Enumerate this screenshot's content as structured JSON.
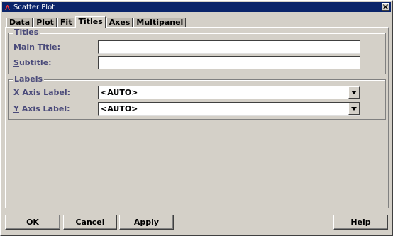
{
  "window": {
    "title": "Scatter Plot"
  },
  "tabs": [
    {
      "label": "Data",
      "active": false
    },
    {
      "label": "Plot",
      "active": false
    },
    {
      "label": "Fit",
      "active": false
    },
    {
      "label": "Titles",
      "active": true
    },
    {
      "label": "Axes",
      "active": false
    },
    {
      "label": "Multipanel",
      "active": false
    }
  ],
  "titles_group": {
    "legend": "Titles",
    "main_title": {
      "label": "Main Title:",
      "value": ""
    },
    "subtitle": {
      "label_mnemonic": "S",
      "label_rest": "ubtitle:",
      "value": ""
    }
  },
  "labels_group": {
    "legend": "Labels",
    "x_axis": {
      "label_mnemonic": "X",
      "label_rest": " Axis Label:",
      "value": "<AUTO>"
    },
    "y_axis": {
      "label_mnemonic": "Y",
      "label_rest": " Axis Label:",
      "value": "<AUTO>"
    }
  },
  "buttons": {
    "ok": "OK",
    "cancel": "Cancel",
    "apply": "Apply",
    "help": "Help"
  },
  "colors": {
    "titlebar": "#0a246a",
    "label_text": "#4a4a7a",
    "face": "#d4d0c8"
  }
}
